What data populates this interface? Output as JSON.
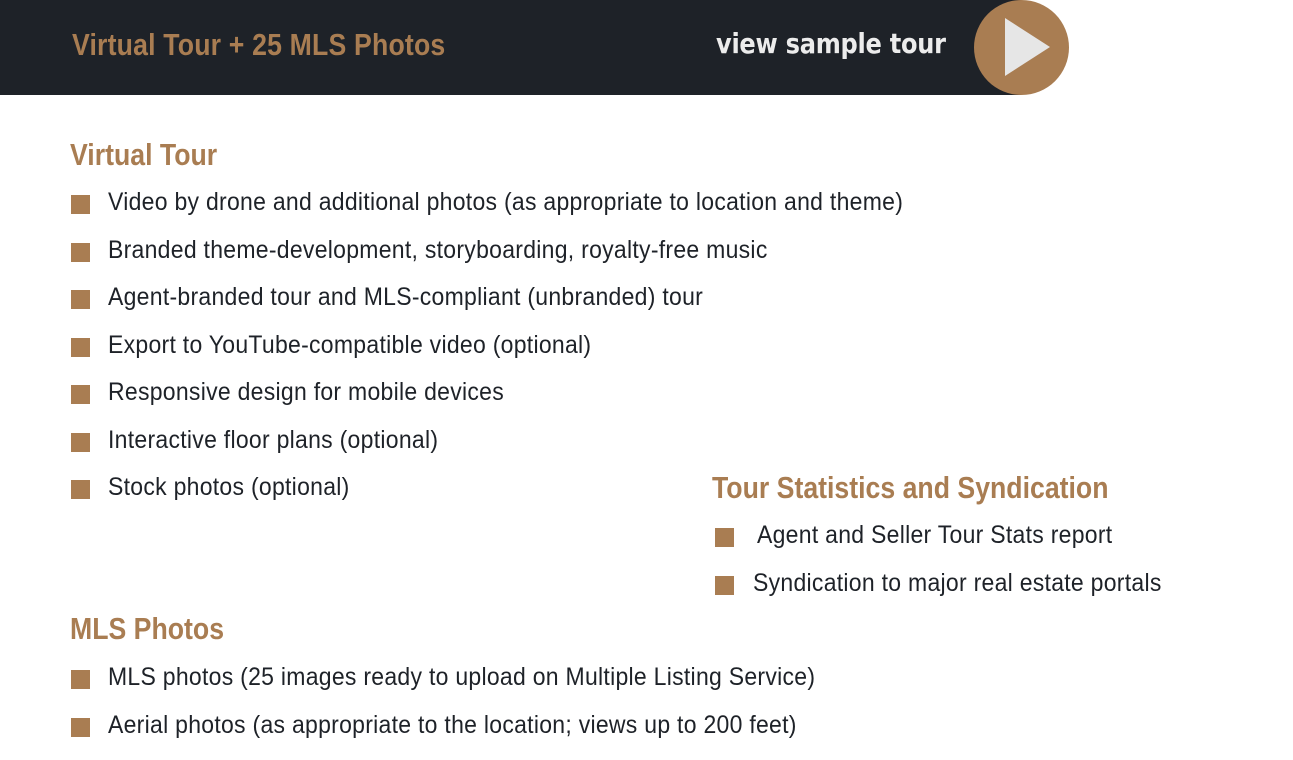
{
  "header": {
    "title": "Virtual Tour + 25 MLS Photos",
    "sample_link": "view sample tour",
    "play_icon": "play-icon"
  },
  "sections": {
    "virtual_tour": {
      "title": "Virtual Tour",
      "items": [
        "Video by drone and additional photos (as appropriate to location and theme)",
        "Branded theme-development, storyboarding, royalty-free music",
        "Agent-branded tour and MLS-compliant (unbranded) tour",
        "Export to YouTube-compatible video (optional)",
        "Responsive design for mobile devices",
        "Interactive floor plans (optional)",
        "Stock photos (optional)"
      ]
    },
    "tour_stats": {
      "title": "Tour Statistics and Syndication",
      "items": [
        "Agent and Seller Tour Stats report",
        "Syndication to major real estate portals"
      ]
    },
    "mls_photos": {
      "title": "MLS Photos",
      "items": [
        "MLS photos (25 images ready to upload on Multiple Listing Service)",
        "Aerial photos (as appropriate to the location; views up to 200 feet)"
      ]
    }
  },
  "colors": {
    "accent": "#a97d52",
    "header_bg": "#1e2228",
    "text": "#1e2228",
    "play_glyph": "#e6e6e6"
  }
}
